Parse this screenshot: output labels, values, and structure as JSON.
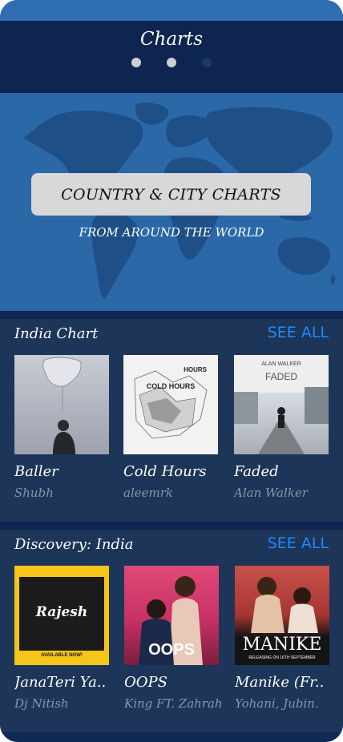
{
  "header": {
    "title": "Charts",
    "page_dots": 3,
    "active_dot": 2
  },
  "hero": {
    "title": "COUNTRY & CITY CHARTS",
    "subtitle": "FROM AROUND THE WORLD"
  },
  "india_chart": {
    "title": "India Chart",
    "see_all": "SEE ALL",
    "items": [
      {
        "song": "Baller",
        "artist": "Shubh",
        "art_text": ""
      },
      {
        "song": "Cold Hours",
        "artist": "aleemrk",
        "art_text": "COLD HOURS",
        "art_top": "HOURS"
      },
      {
        "song": "Faded",
        "artist": "Alan Walker",
        "art_text": "FADED",
        "art_top": "ALAN WALKER"
      }
    ]
  },
  "discovery": {
    "title": "Discovery: India",
    "see_all": "SEE ALL",
    "items": [
      {
        "song": "JanaTeri Ya..",
        "artist": "Dj Nitish",
        "art_text": "Rajesh",
        "art_bottom": "AVAILABLE NOW!"
      },
      {
        "song": "OOPS",
        "artist": "King FT. Zahrah",
        "art_text": "OOPS"
      },
      {
        "song": "Manike (Fr..",
        "artist": "Yohani, Jubin.",
        "art_text": "MANIKE",
        "art_bottom": "RELEASING ON 16TH SEPTEMBER"
      }
    ]
  },
  "colors": {
    "background": "#0f2a55",
    "hero": "#2b68a8",
    "section": "#1c3558",
    "accent": "#1e8bff",
    "muted_text": "#8896aa"
  }
}
